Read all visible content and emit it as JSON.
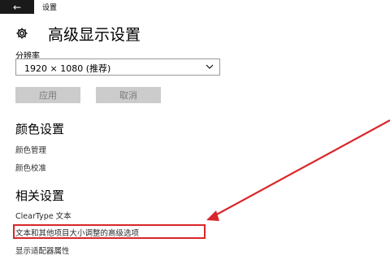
{
  "window": {
    "title": "设置"
  },
  "nav": {
    "back_icon": "arrow-left-icon",
    "back_glyph": "←"
  },
  "page": {
    "title": "高级显示设置",
    "icon": "gear-icon"
  },
  "resolution": {
    "label": "分辨率",
    "selected": "1920 × 1080 (推荐)"
  },
  "actions": {
    "apply": "应用",
    "cancel": "取消"
  },
  "color_section": {
    "title": "颜色设置",
    "links": [
      "颜色管理",
      "颜色校准"
    ]
  },
  "related_section": {
    "title": "相关设置",
    "links": [
      "ClearType 文本",
      "文本和其他项目大小调整的高级选项",
      "显示适配器属性"
    ]
  },
  "annotation": {
    "color": "#d9262a",
    "highlighted_item": "文本和其他项目大小调整的高级选项"
  },
  "colors": {
    "button_disabled_bg": "#cccccc",
    "button_disabled_text": "#7a7a7a",
    "back_bg": "#1a1a1a"
  }
}
